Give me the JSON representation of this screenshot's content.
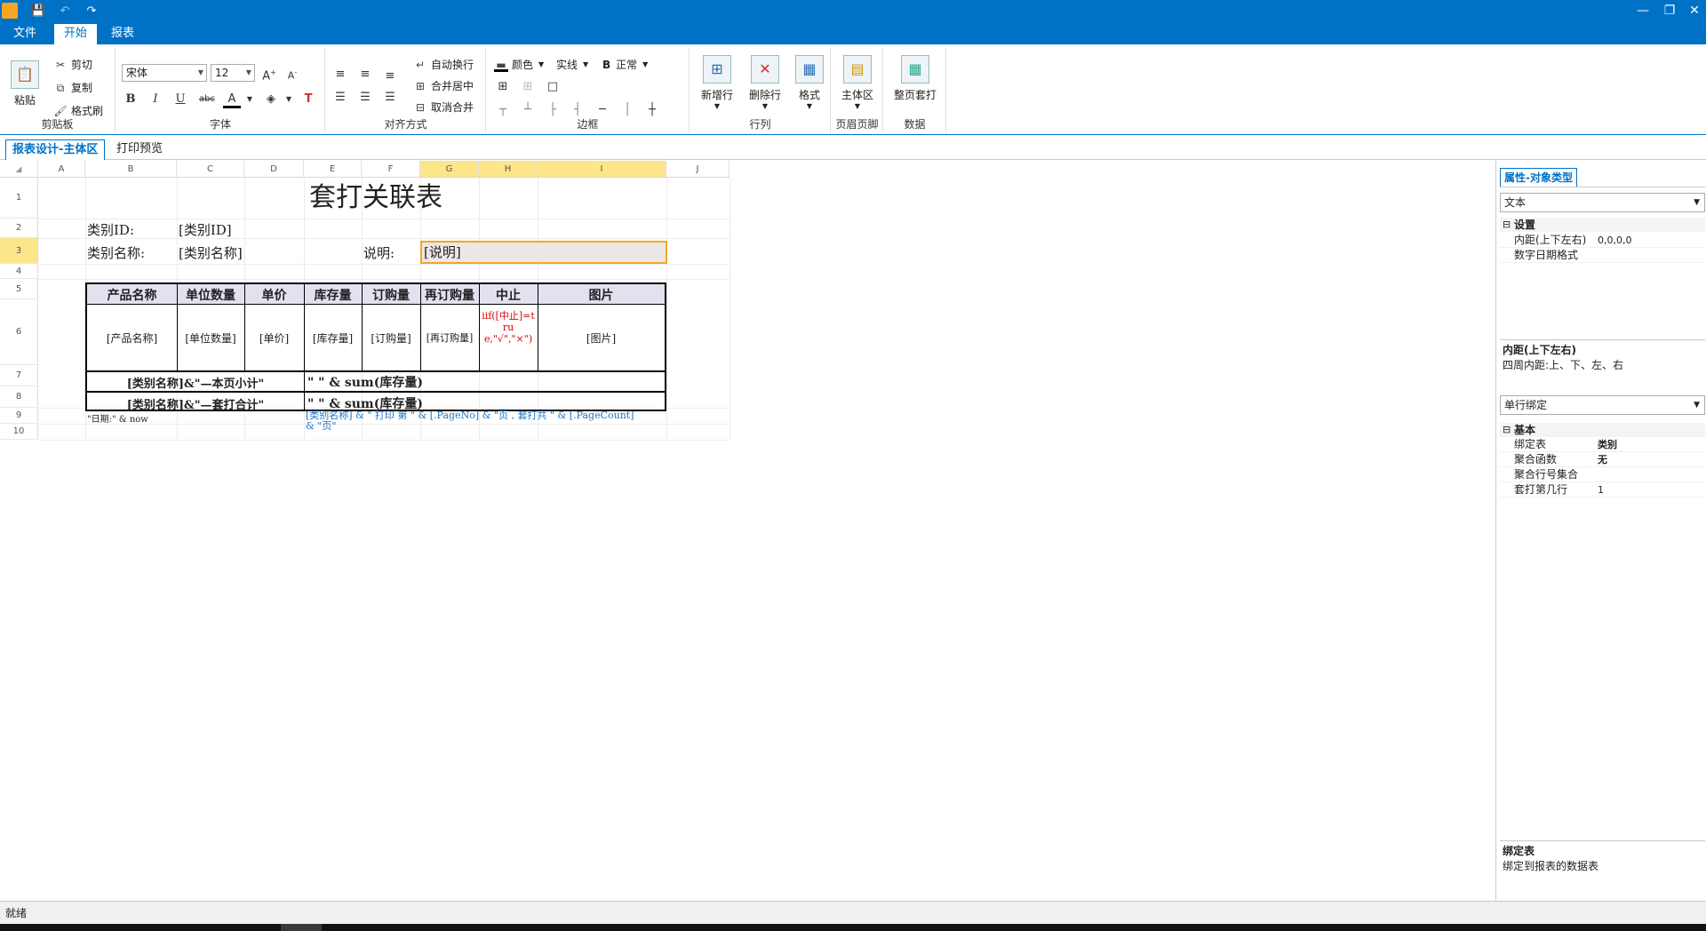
{
  "titlebar": {
    "undo": "↶",
    "redo": "↷",
    "save": "💾",
    "minimize": "—",
    "restore": "❐",
    "close": "✕"
  },
  "menu": {
    "items": [
      {
        "label": "文件"
      },
      {
        "label": "开始"
      },
      {
        "label": "报表"
      }
    ]
  },
  "ribbon": {
    "clipboard": {
      "paste": "粘贴",
      "cut": "剪切",
      "copy": "复制",
      "painter": "格式刷",
      "group": "剪贴板"
    },
    "font": {
      "family": "宋体",
      "size": "12",
      "group": "字体",
      "bold": "B",
      "italic": "I",
      "underline": "U",
      "strike": "abc"
    },
    "align": {
      "wrap": "自动换行",
      "merge": "合并居中",
      "unmerge": "取消合并",
      "group": "对齐方式"
    },
    "border": {
      "color": "颜色",
      "style": "实线",
      "weight": "正常",
      "weight_label": "B",
      "group": "边框"
    },
    "rows": {
      "add": "新增行",
      "del": "删除行",
      "format": "格式",
      "group": "行列"
    },
    "headfoot": {
      "main": "主体区",
      "group": "页眉页脚"
    },
    "data": {
      "print": "整页套打",
      "group": "数据"
    }
  },
  "doctabs": [
    {
      "label": "报表设计-主体区"
    },
    {
      "label": "打印预览"
    }
  ],
  "grid": {
    "columns": [
      "A",
      "B",
      "C",
      "D",
      "E",
      "F",
      "G",
      "H",
      "I",
      "J"
    ],
    "rows": [
      "1",
      "2",
      "3",
      "4",
      "5",
      "6",
      "7",
      "8",
      "9",
      "10"
    ],
    "title": "套打关联表",
    "r2": {
      "label": "类别ID:",
      "value": "[类别ID]"
    },
    "r3": {
      "label": "类别名称:",
      "value": "[类别名称]",
      "note_label": "说明:",
      "note_value": "[说明]"
    },
    "table": {
      "headers": [
        "产品名称",
        "单位数量",
        "单价",
        "库存量",
        "订购量",
        "再订购量",
        "中止",
        "图片"
      ],
      "values": [
        "[产品名称]",
        "[单位数量]",
        "[单价]",
        "[库存量]",
        "[订购量]",
        "[再订购量]",
        "iif([中止]=true,\"√\",\"×\")",
        "[图片]"
      ],
      "subtotal_label": "[类别名称]&\"—本页小计\"",
      "subtotal_value": "\" \" & sum(库存量)",
      "total_label": "[类别名称]&\"—套打合计\"",
      "total_value": "\" \" & sum(库存量)"
    },
    "r9": {
      "date": "\"日期:\" & now",
      "page": "[类别名称] & \" 打印 第 \" & [.PageNo] & \"页 , 套打共 \" & [.PageCount] & \"页\""
    }
  },
  "props": {
    "tab": "属性-对象类型",
    "type_value": "文本",
    "settings": {
      "cat": "设置",
      "rows": [
        {
          "k": "内距(上下左右)",
          "v": "0,0,0,0"
        },
        {
          "k": "数字日期格式",
          "v": ""
        }
      ]
    },
    "desc1": {
      "title": "内距(上下左右)",
      "text": "四周内距:上、下、左、右"
    },
    "bind_combo": "单行绑定",
    "basic": {
      "cat": "基本",
      "rows": [
        {
          "k": "绑定表",
          "v": "类别"
        },
        {
          "k": "聚合函数",
          "v": "无"
        },
        {
          "k": "聚合行号集合",
          "v": ""
        },
        {
          "k": "套打第几行",
          "v": "1"
        }
      ]
    },
    "desc2": {
      "title": "绑定表",
      "text": "绑定到报表的数据表"
    }
  },
  "status": {
    "text": "就绪"
  },
  "colors": {
    "accent": "#0072c6",
    "selection": "#fde68a",
    "header_fill": "#e4e0ee",
    "red_text": "#e00000",
    "blue_text": "#1a73c8"
  }
}
